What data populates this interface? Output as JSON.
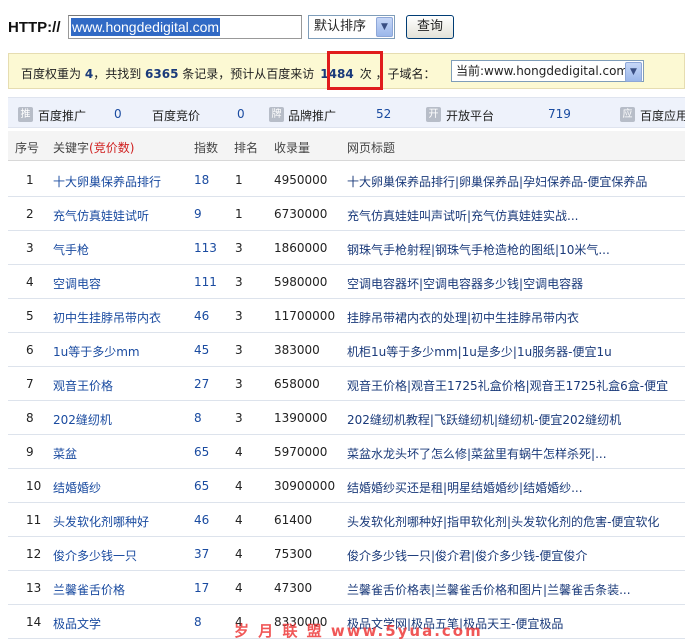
{
  "query_bar": {
    "http_label": "HTTP://",
    "url_value": "www.hongdedigital.com",
    "sort_value": "默认排序",
    "query_button": "查询"
  },
  "info": {
    "text_prefix": "百度权重为",
    "weight": "4",
    "text_found": "，共找到",
    "records": "6365",
    "text_records": "条记录，预计从百度来访",
    "visits": "1484",
    "text_suffix": "次 ，子域名：",
    "subdomain_value": "当前:www.hongdedigital.com"
  },
  "stats": [
    {
      "icon": "推",
      "label": "百度推广",
      "value": "0"
    },
    {
      "icon": "",
      "label": "百度竞价",
      "value": "0"
    },
    {
      "icon": "牌",
      "label": "品牌推广",
      "value": "52"
    },
    {
      "icon": "开",
      "label": "开放平台",
      "value": "719"
    },
    {
      "icon": "应",
      "label": "百度应用",
      "value": ""
    }
  ],
  "table": {
    "headers": {
      "idx": "序号",
      "keyword": "关键字",
      "keyword_note": "(竞价数)",
      "index": "指数",
      "rank": "排名",
      "count": "收录量",
      "title": "网页标题"
    },
    "rows": [
      {
        "idx": "1",
        "keyword": "十大卵巢保养品排行",
        "index": "18",
        "rank": "1",
        "count": "4950000",
        "title": "十大卵巢保养品排行|卵巢保养品|孕妇保养品-便宜保养品"
      },
      {
        "idx": "2",
        "keyword": "充气仿真娃娃试听",
        "index": "9",
        "rank": "1",
        "count": "6730000",
        "title": "充气仿真娃娃叫声试听|充气仿真娃娃实战..."
      },
      {
        "idx": "3",
        "keyword": "气手枪",
        "index": "113",
        "rank": "3",
        "count": "1860000",
        "title": "钢珠气手枪射程|钢珠气手枪造枪的图纸|10米气..."
      },
      {
        "idx": "4",
        "keyword": "空调电容",
        "index": "111",
        "rank": "3",
        "count": "5980000",
        "title": "空调电容器坏|空调电容器多少钱|空调电容器"
      },
      {
        "idx": "5",
        "keyword": "初中生挂脖吊带内衣",
        "index": "46",
        "rank": "3",
        "count": "11700000",
        "title": "挂脖吊带裙内衣的处理|初中生挂脖吊带内衣"
      },
      {
        "idx": "6",
        "keyword": "1u等于多少mm",
        "index": "45",
        "rank": "3",
        "count": "383000",
        "title": "机柜1u等于多少mm|1u是多少|1u服务器-便宜1u"
      },
      {
        "idx": "7",
        "keyword": "观音王价格",
        "index": "27",
        "rank": "3",
        "count": "658000",
        "title": "观音王价格|观音王1725礼盒价格|观音王1725礼盒6盒-便宜"
      },
      {
        "idx": "8",
        "keyword": "202缝纫机",
        "index": "8",
        "rank": "3",
        "count": "1390000",
        "title": "202缝纫机教程|飞跃缝纫机|缝纫机-便宜202缝纫机"
      },
      {
        "idx": "9",
        "keyword": "菜盆",
        "index": "65",
        "rank": "4",
        "count": "5970000",
        "title": "菜盆水龙头坏了怎么修|菜盆里有蜗牛怎样杀死|..."
      },
      {
        "idx": "10",
        "keyword": "结婚婚纱",
        "index": "65",
        "rank": "4",
        "count": "30900000",
        "title": "结婚婚纱买还是租|明星结婚婚纱|结婚婚纱..."
      },
      {
        "idx": "11",
        "keyword": "头发软化剂哪种好",
        "index": "46",
        "rank": "4",
        "count": "61400",
        "title": "头发软化剂哪种好|指甲软化剂|头发软化剂的危害-便宜软化"
      },
      {
        "idx": "12",
        "keyword": "俊介多少钱一只",
        "index": "37",
        "rank": "4",
        "count": "75300",
        "title": "俊介多少钱一只|俊介君|俊介多少钱-便宜俊介"
      },
      {
        "idx": "13",
        "keyword": "兰馨雀舌价格",
        "index": "17",
        "rank": "4",
        "count": "47300",
        "title": "兰馨雀舌价格表|兰馨雀舌价格和图片|兰馨雀舌条装..."
      },
      {
        "idx": "14",
        "keyword": "极品文学",
        "index": "8",
        "rank": "4",
        "count": "8330000",
        "title": "极品文学网|极品五笔|极品天王-便宜极品"
      }
    ]
  },
  "watermark": "岁 月 联 盟   www.5yua.com"
}
